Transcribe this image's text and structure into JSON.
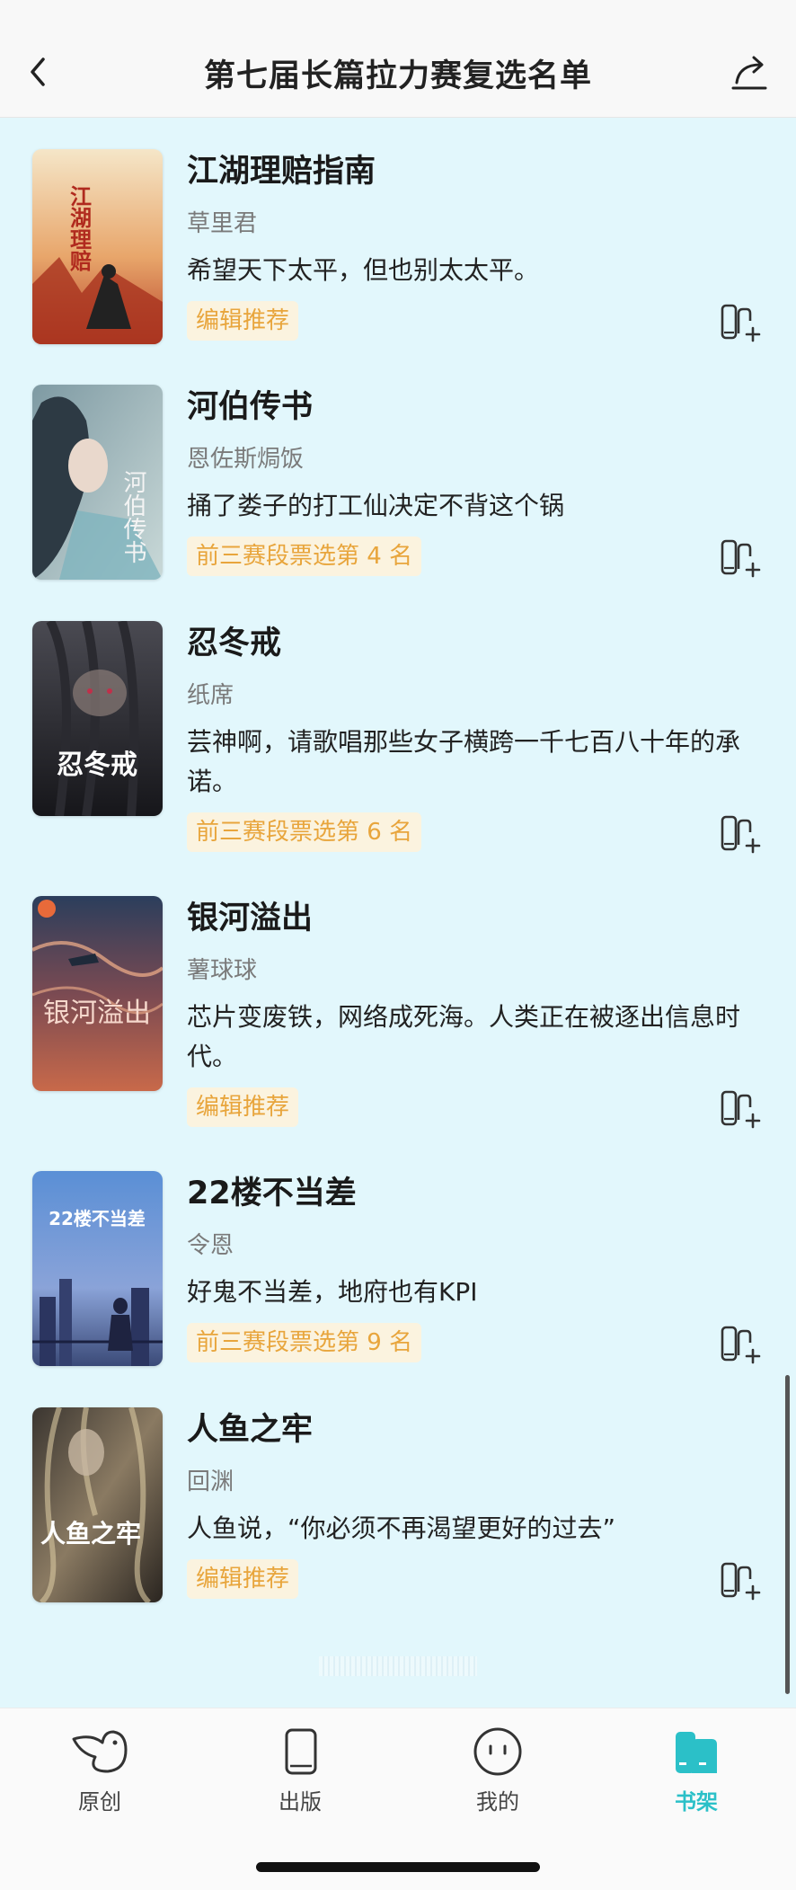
{
  "header": {
    "title": "第七届长篇拉力赛复选名单",
    "back_icon": "chevron-left-icon",
    "share_icon": "share-icon"
  },
  "books": [
    {
      "title": "江湖理赔指南",
      "author": "草里君",
      "desc": "希望天下太平，但也别太太平。",
      "tag": "编辑推荐",
      "cover_text": "江湖理赔"
    },
    {
      "title": "河伯传书",
      "author": "恩佐斯焗饭",
      "desc": "捅了娄子的打工仙决定不背这个锅",
      "tag": "前三赛段票选第 4 名",
      "cover_text": "河伯传书"
    },
    {
      "title": "忍冬戒",
      "author": "纸席",
      "desc": "芸神啊，请歌唱那些女子横跨一千七百八十年的承诺。",
      "tag": "前三赛段票选第 6 名",
      "cover_text": "忍冬戒"
    },
    {
      "title": "银河溢出",
      "author": "薯球球",
      "desc": "芯片变废铁，网络成死海。人类正在被逐出信息时代。",
      "tag": "编辑推荐",
      "cover_text": "银河溢出"
    },
    {
      "title": "22楼不当差",
      "author": "令恩",
      "desc": "好鬼不当差，地府也有KPI",
      "tag": "前三赛段票选第 9 名",
      "cover_text": "22楼不当差"
    },
    {
      "title": "人鱼之牢",
      "author": "回渊",
      "desc": "人鱼说，“你必须不再渴望更好的过去”",
      "tag": "编辑推荐",
      "cover_text": "人鱼之牢"
    }
  ],
  "tabbar": {
    "items": [
      {
        "label": "原创",
        "icon": "bird-icon"
      },
      {
        "label": "出版",
        "icon": "book-icon"
      },
      {
        "label": "我的",
        "icon": "face-icon"
      },
      {
        "label": "书架",
        "icon": "bookshelf-icon"
      }
    ],
    "active_index": 3,
    "active_color": "#2bc0c8"
  },
  "colors": {
    "list_background": "#e2f7fc",
    "tag_text": "#e8a53c",
    "tag_background": "#fbf3df"
  }
}
